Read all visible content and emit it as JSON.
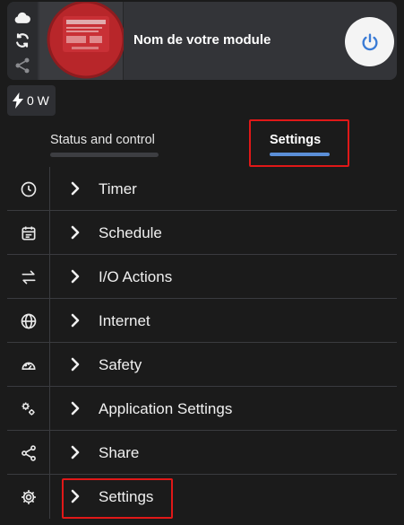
{
  "device": {
    "name": "Nom de votre module"
  },
  "power": {
    "watt_label": "0 W"
  },
  "tabs": [
    {
      "label": "Status and control",
      "active": false
    },
    {
      "label": "Settings",
      "active": true
    }
  ],
  "menu": {
    "items": [
      {
        "label": "Timer",
        "icon": "clock-icon"
      },
      {
        "label": "Schedule",
        "icon": "calendar-icon"
      },
      {
        "label": "I/O Actions",
        "icon": "swap-arrows-icon"
      },
      {
        "label": "Internet",
        "icon": "globe-icon"
      },
      {
        "label": "Safety",
        "icon": "gauge-icon"
      },
      {
        "label": "Application Settings",
        "icon": "gears-icon"
      },
      {
        "label": "Share",
        "icon": "share-icon"
      },
      {
        "label": "Settings",
        "icon": "gear-icon"
      }
    ]
  },
  "colors": {
    "background": "#1b1b1b",
    "card": "#333438",
    "accent": "#5b8fd8",
    "highlight": "#e01818"
  }
}
